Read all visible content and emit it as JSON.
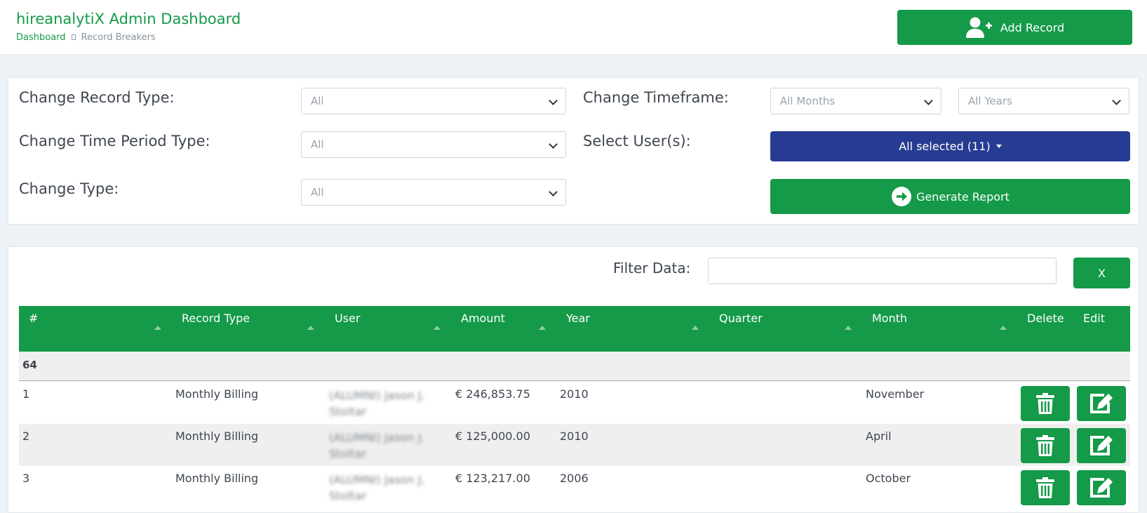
{
  "header": {
    "app_title": "hireanalytiX Admin Dashboard",
    "breadcrumb": {
      "home": "Dashboard",
      "current": "Record Breakers"
    },
    "add_record_label": "Add Record"
  },
  "filters": {
    "record_type": {
      "label": "Change Record Type:",
      "value": "All"
    },
    "timeframe": {
      "label": "Change Timeframe:",
      "month_value": "All Months",
      "year_value": "All Years"
    },
    "time_period_type": {
      "label": "Change Time Period Type:",
      "value": "All"
    },
    "users": {
      "label": "Select User(s):",
      "button_label": "All selected (11)"
    },
    "change_type": {
      "label": "Change Type:",
      "value": "All"
    },
    "generate_label": "Generate Report"
  },
  "table_panel": {
    "filter_label": "Filter Data:",
    "filter_value": "",
    "clear_label": "X",
    "columns": [
      "#",
      "Record Type",
      "User",
      "Amount",
      "Year",
      "Quarter",
      "Month",
      "Delete",
      "Edit"
    ],
    "group_label": "64",
    "rows": [
      {
        "num": "1",
        "record_type": "Monthly Billing",
        "user": "(ALUMNI) Jason J. Stoltar",
        "amount": "€ 246,853.75",
        "year": "2010",
        "quarter": "",
        "month": "November"
      },
      {
        "num": "2",
        "record_type": "Monthly Billing",
        "user": "(ALUMNI) Jason J. Stoltar",
        "amount": "€ 125,000.00",
        "year": "2010",
        "quarter": "",
        "month": "April"
      },
      {
        "num": "3",
        "record_type": "Monthly Billing",
        "user": "(ALUMNI) Jason J. Stoltar",
        "amount": "€ 123,217.00",
        "year": "2006",
        "quarter": "",
        "month": "October"
      }
    ]
  },
  "colors": {
    "brand_green": "#149a48",
    "users_button_blue": "#273b92",
    "page_bg": "#edf2f6"
  },
  "icons": [
    "add-user-icon",
    "arrow-right-circle-icon",
    "trash-icon",
    "edit-icon",
    "sort-up-icon",
    "chevron-down-icon"
  ]
}
